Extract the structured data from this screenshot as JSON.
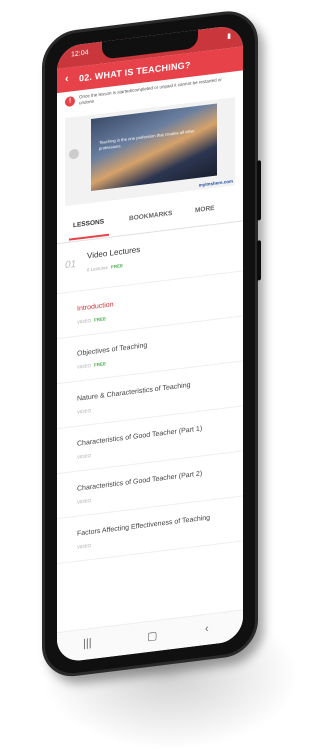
{
  "status": {
    "time": "12:04",
    "battery_icon": "battery-icon"
  },
  "header": {
    "back_icon": "back-arrow-icon",
    "title": "02. WHAT IS TEACHING?"
  },
  "notice": {
    "text": "Once the lesson is started/completed or unpaid it cannot be restarted or undone"
  },
  "video": {
    "quote": "Teaching is the one profession that creates all other professions.",
    "brand": "mylmshere.com",
    "play_icon": "play-icon"
  },
  "tabs": [
    {
      "label": "LESSONS"
    },
    {
      "label": "BOOKMARKS"
    },
    {
      "label": "MORE"
    }
  ],
  "section": {
    "number": "01",
    "name": "Video Lectures",
    "meta": "6 Lectures",
    "free": "FREE"
  },
  "lessons": [
    {
      "name": "Introduction",
      "meta": "VIDEO",
      "free": "FREE",
      "active": true
    },
    {
      "name": "Objectives of Teaching",
      "meta": "VIDEO",
      "free": "FREE",
      "active": false
    },
    {
      "name": "Nature & Characteristics of Teaching",
      "meta": "VIDEO",
      "free": "",
      "active": false
    },
    {
      "name": "Characteristics of Good Teacher (Part 1)",
      "meta": "VIDEO",
      "free": "",
      "active": false
    },
    {
      "name": "Characteristics of Good Teacher (Part 2)",
      "meta": "VIDEO",
      "free": "",
      "active": false
    },
    {
      "name": "Factors Affecting Effectiveness of Teaching",
      "meta": "VIDEO",
      "free": "",
      "active": false
    }
  ],
  "navbar": {
    "recent_icon": "recent-apps-icon",
    "home_icon": "home-icon",
    "back_icon": "back-nav-icon"
  },
  "colors": {
    "accent": "#e7424a",
    "free_green": "#4caf50"
  }
}
